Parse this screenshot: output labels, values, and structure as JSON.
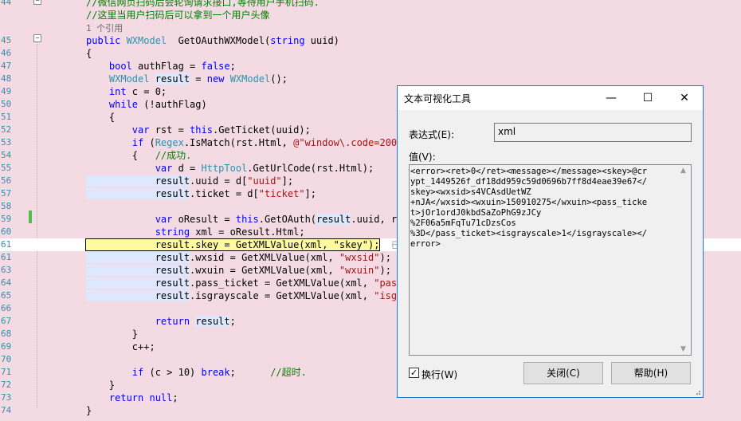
{
  "editor": {
    "lines": [
      {
        "n": "44",
        "tokens": [
          [
            "cm",
            "//微信网页扫码后会轮询请求接口,等待用户手机扫码."
          ]
        ]
      },
      {
        "n": "",
        "tokens": [
          [
            "cm",
            "//这里当用户扫码后可以拿到一个用户头像"
          ]
        ]
      },
      {
        "n": "",
        "tokens": [
          [
            "ref",
            "1 个引用"
          ]
        ]
      },
      {
        "n": "45",
        "tokens": [
          [
            "kw",
            "public "
          ],
          [
            "ty",
            "WXModel"
          ],
          [
            "",
            "  GetOAuthWXModel("
          ],
          [
            "kw",
            "string"
          ],
          [
            "",
            " uuid)"
          ]
        ]
      },
      {
        "n": "46",
        "tokens": [
          [
            "",
            "{"
          ]
        ]
      },
      {
        "n": "47",
        "tokens": [
          [
            "kw",
            "    bool"
          ],
          [
            "",
            " authFlag = "
          ],
          [
            "kw",
            "false"
          ],
          [
            "",
            ";"
          ]
        ]
      },
      {
        "n": "48",
        "tokens": [
          [
            "ty",
            "    WXModel"
          ],
          [
            "",
            " "
          ],
          [
            "sel",
            "result"
          ],
          [
            "",
            " = "
          ],
          [
            "kw",
            "new"
          ],
          [
            "",
            " "
          ],
          [
            "ty",
            "WXModel"
          ],
          [
            "",
            "();"
          ]
        ]
      },
      {
        "n": "49",
        "tokens": [
          [
            "kw",
            "    int"
          ],
          [
            "",
            " c = 0;"
          ]
        ]
      },
      {
        "n": "50",
        "tokens": [
          [
            "kw",
            "    while"
          ],
          [
            "",
            " (!authFlag)"
          ]
        ]
      },
      {
        "n": "51",
        "tokens": [
          [
            "",
            "    {"
          ]
        ]
      },
      {
        "n": "52",
        "tokens": [
          [
            "kw",
            "        var"
          ],
          [
            "",
            " rst = "
          ],
          [
            "kw",
            "this"
          ],
          [
            "",
            ".GetTicket(uuid);"
          ]
        ]
      },
      {
        "n": "53",
        "tokens": [
          [
            "kw",
            "        if"
          ],
          [
            "",
            " ("
          ],
          [
            "ty",
            "Regex"
          ],
          [
            "",
            ".IsMatch(rst.Html, "
          ],
          [
            "str",
            "@\"window\\.code=200\""
          ],
          [
            "",
            ")"
          ]
        ]
      },
      {
        "n": "54",
        "tokens": [
          [
            "",
            "        {   "
          ],
          [
            "cm",
            "//成功."
          ]
        ]
      },
      {
        "n": "55",
        "tokens": [
          [
            "kw",
            "            var"
          ],
          [
            "",
            " d = "
          ],
          [
            "ty",
            "HttpTool"
          ],
          [
            "",
            ".GetUrlCode(rst.Html);"
          ]
        ]
      },
      {
        "n": "56",
        "tokens": [
          [
            "sel",
            "            result"
          ],
          [
            "",
            ".uuid = d["
          ],
          [
            "str",
            "\"uuid\""
          ],
          [
            "",
            "];"
          ]
        ]
      },
      {
        "n": "57",
        "tokens": [
          [
            "sel",
            "            result"
          ],
          [
            "",
            ".ticket = d["
          ],
          [
            "str",
            "\"ticket\""
          ],
          [
            "",
            "];"
          ]
        ]
      },
      {
        "n": "58",
        "tokens": [
          [
            "",
            ""
          ]
        ]
      },
      {
        "n": "59",
        "tokens": [
          [
            "kw",
            "            var"
          ],
          [
            "",
            " oResult = "
          ],
          [
            "kw",
            "this"
          ],
          [
            "",
            ".GetOAuth("
          ],
          [
            "sel",
            "result"
          ],
          [
            "",
            ".uuid, res"
          ]
        ]
      },
      {
        "n": "60",
        "tokens": [
          [
            "kw",
            "            string"
          ],
          [
            "",
            " xml = oResult.Html;"
          ]
        ]
      },
      {
        "n": "61",
        "current": true,
        "tokens": [
          [
            "hl",
            "            result.skey = GetXMLValue(xml, \"skey\");"
          ],
          [
            "",
            "  "
          ],
          [
            "hint",
            "已用"
          ]
        ]
      },
      {
        "n": "61",
        "tokens": [
          [
            "sel",
            "            result"
          ],
          [
            "",
            ".wxsid = GetXMLValue(xml, "
          ],
          [
            "str",
            "\"wxsid\""
          ],
          [
            "",
            ");"
          ]
        ]
      },
      {
        "n": "63",
        "tokens": [
          [
            "sel",
            "            result"
          ],
          [
            "",
            ".wxuin = GetXMLValue(xml, "
          ],
          [
            "str",
            "\"wxuin\""
          ],
          [
            "",
            ");"
          ]
        ]
      },
      {
        "n": "64",
        "tokens": [
          [
            "sel",
            "            result"
          ],
          [
            "",
            ".pass_ticket = GetXMLValue(xml, "
          ],
          [
            "str",
            "\"pass_"
          ]
        ]
      },
      {
        "n": "65",
        "tokens": [
          [
            "sel",
            "            result"
          ],
          [
            "",
            ".isgrayscale = GetXMLValue(xml, "
          ],
          [
            "str",
            "\"isgra"
          ]
        ]
      },
      {
        "n": "66",
        "tokens": [
          [
            "",
            ""
          ]
        ]
      },
      {
        "n": "67",
        "tokens": [
          [
            "kw",
            "            return"
          ],
          [
            "",
            " "
          ],
          [
            "sel",
            "result"
          ],
          [
            "",
            ";"
          ]
        ]
      },
      {
        "n": "68",
        "tokens": [
          [
            "",
            "        }"
          ]
        ]
      },
      {
        "n": "69",
        "tokens": [
          [
            "",
            "        c++;"
          ]
        ]
      },
      {
        "n": "70",
        "tokens": [
          [
            "",
            ""
          ]
        ]
      },
      {
        "n": "71",
        "tokens": [
          [
            "kw",
            "        if"
          ],
          [
            "",
            " (c > 10) "
          ],
          [
            "kw",
            "break"
          ],
          [
            "",
            ";      "
          ],
          [
            "cm",
            "//超时."
          ]
        ]
      },
      {
        "n": "72",
        "tokens": [
          [
            "",
            "    }"
          ]
        ]
      },
      {
        "n": "73",
        "tokens": [
          [
            "kw",
            "    return"
          ],
          [
            "",
            " "
          ],
          [
            "kw",
            "null"
          ],
          [
            "",
            ";"
          ]
        ]
      },
      {
        "n": "74",
        "tokens": [
          [
            "",
            "}"
          ]
        ]
      }
    ]
  },
  "dialog": {
    "title": "文本可视化工具",
    "minimize_glyph": "—",
    "maximize_glyph": "☐",
    "close_glyph": "✕",
    "expression_label": "表达式(E):",
    "expression_value": "xml",
    "value_label": "值(V):",
    "value_text": "<error><ret>0</ret><message></message><skey>@cr\nypt_1449526f_df18dd959c59d0696b7ff8d4eae39e67</\nskey><wxsid>s4VCAsdUetWZ\n+nJA</wxsid><wxuin>150910275</wxuin><pass_ticke\nt>jOr1ordJ0kbdSaZoPhG9zJCy\n%2F06a5mFqTu71cDzsCos\n%3D</pass_ticket><isgrayscale>1</isgrayscale></\nerror>",
    "wrap_label": "换行(W)",
    "wrap_checked": "✓",
    "close_button": "关闭(C)",
    "help_button": "帮助(H)"
  }
}
